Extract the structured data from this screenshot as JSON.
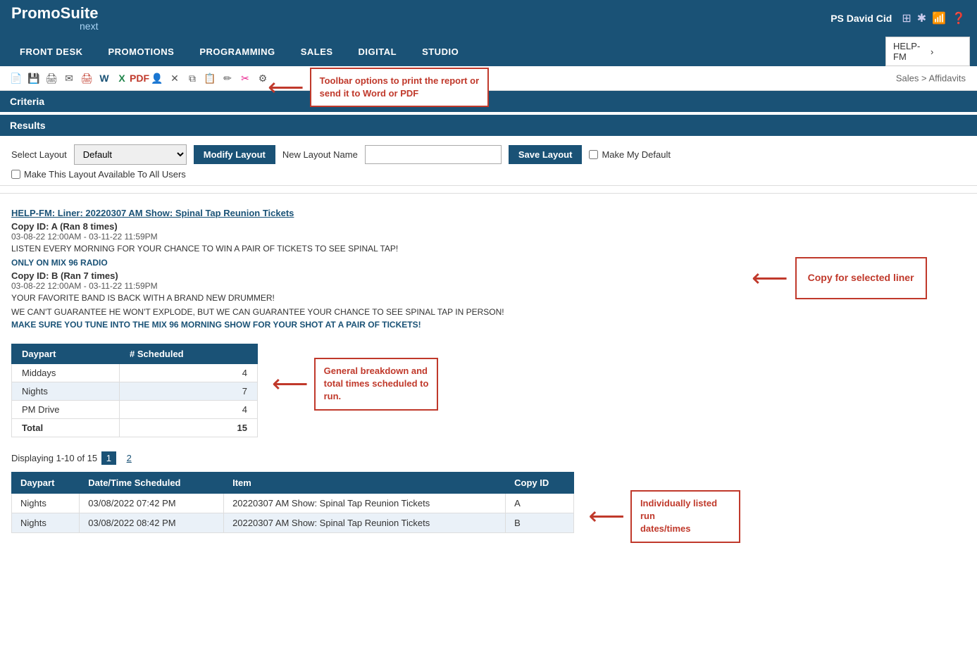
{
  "app": {
    "title": "PromoSuite",
    "subtitle": "next",
    "user": "PS David Cid"
  },
  "nav": {
    "items": [
      "FRONT DESK",
      "PROMOTIONS",
      "PROGRAMMING",
      "SALES",
      "DIGITAL",
      "STUDIO"
    ],
    "station": "HELP-FM"
  },
  "toolbar": {
    "callout_text": "Toolbar options to print the report or\nsend it to Word or PDF",
    "breadcrumb": "Sales > Affidavits"
  },
  "sections": {
    "criteria": "Criteria",
    "results": "Results"
  },
  "layout": {
    "select_label": "Select Layout",
    "select_value": "Default",
    "modify_btn": "Modify Layout",
    "new_layout_label": "New Layout Name",
    "new_layout_placeholder": "",
    "save_btn": "Save Layout",
    "make_default_label": "Make My Default",
    "make_available_label": "Make This Layout Available To All Users"
  },
  "report": {
    "title": "HELP-FM: Liner: 20220307 AM Show: Spinal Tap Reunion Tickets",
    "copy_a_label": "Copy ID: A (Ran 8 times)",
    "copy_a_date": "03-08-22 12:00AM - 03-11-22 11:59PM",
    "copy_a_text": "LISTEN EVERY MORNING FOR YOUR CHANCE TO WIN A PAIR OF TICKETS TO SEE SPINAL TAP!",
    "copy_b_blue": "ONLY ON MIX 96 RADIO",
    "copy_b_label": "Copy ID: B (Ran 7 times)",
    "copy_b_date": "03-08-22 12:00AM - 03-11-22 11:59PM",
    "copy_b_text1": "YOUR FAVORITE BAND IS BACK WITH A BRAND NEW DRUMMER!",
    "copy_b_text2": "WE CAN'T GUARANTEE HE WON'T EXPLODE, BUT WE CAN GUARANTEE YOUR CHANCE TO SEE SPINAL TAP IN PERSON!",
    "copy_b_text3": "MAKE SURE YOU TUNE INTO THE MIX 96 MORNING SHOW FOR YOUR SHOT AT A PAIR OF TICKETS!"
  },
  "callouts": {
    "copy_for_liner": "Copy for selected liner",
    "general_breakdown": "General breakdown and\ntotal times scheduled to\nrun.",
    "individually_listed": "Individually listed run\ndates/times"
  },
  "daypart_table": {
    "headers": [
      "Daypart",
      "# Scheduled"
    ],
    "rows": [
      {
        "daypart": "Middays",
        "scheduled": "4"
      },
      {
        "daypart": "Nights",
        "scheduled": "7"
      },
      {
        "daypart": "PM Drive",
        "scheduled": "4"
      }
    ],
    "total_label": "Total",
    "total_value": "15"
  },
  "pagination": {
    "display_text": "Displaying 1-10 of 15",
    "page1": "1",
    "page2": "2"
  },
  "main_table": {
    "headers": [
      "Daypart",
      "Date/Time Scheduled",
      "Item",
      "Copy ID"
    ],
    "rows": [
      {
        "daypart": "Nights",
        "datetime": "03/08/2022 07:42 PM",
        "item": "20220307 AM Show: Spinal Tap Reunion Tickets",
        "copy_id": "A"
      },
      {
        "daypart": "Nights",
        "datetime": "03/08/2022 08:42 PM",
        "item": "20220307 AM Show: Spinal Tap Reunion Tickets",
        "copy_id": "B"
      }
    ]
  }
}
